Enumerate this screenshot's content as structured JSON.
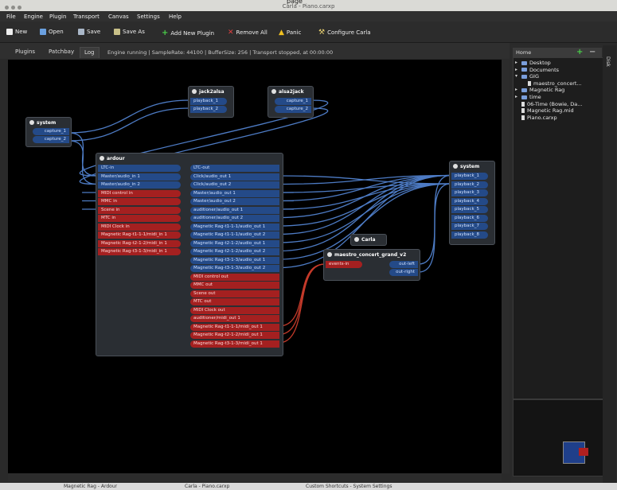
{
  "window": {
    "title": "Carla - Piano.carxp",
    "page_title_left": "page"
  },
  "menu": [
    "File",
    "Engine",
    "Plugin",
    "Transport",
    "Canvas",
    "Settings",
    "Help"
  ],
  "toolbar": [
    "New",
    "Open",
    "Save",
    "Save As",
    "Add New Plugin",
    "Remove All",
    "Panic",
    "Configure Carla"
  ],
  "tabs": [
    "Plugins",
    "Patchbay",
    "Log"
  ],
  "status": "Engine running | SampleRate: 44100 | BufferSize: 256 | Transport stopped, at 00:00:00",
  "nodes": {
    "system_in": {
      "title": "system",
      "ports": [
        "capture_1",
        "capture_2"
      ]
    },
    "jack2alsa": {
      "title": "jack2alsa",
      "ports": [
        "playback_1",
        "playback_2"
      ]
    },
    "alsa2jack": {
      "title": "alsa2jack",
      "ports": [
        "capture_1",
        "capture_2"
      ]
    },
    "ardour": {
      "title": "ardour",
      "inputs": [
        "LTC-in",
        "Master/audio_in 1",
        "Master/audio_in 2",
        "MIDI control in",
        "MMC in",
        "Scene in",
        "MTC in",
        "MIDI Clock in",
        "Magnetic Rag-t1-1-1/midi_in 1",
        "Magnetic Rag-t2-1-2/midi_in 1",
        "Magnetic Rag-t3-1-3/midi_in 1"
      ],
      "input_types": [
        "a",
        "a",
        "a",
        "m",
        "m",
        "m",
        "m",
        "m",
        "m",
        "m",
        "m"
      ],
      "outputs": [
        "LTC-out",
        "Click/audio_out 1",
        "Click/audio_out 2",
        "Master/audio_out 1",
        "Master/audio_out 2",
        "auditioner/audio_out 1",
        "auditioner/audio_out 2",
        "Magnetic Rag-t1-1-1/audio_out 1",
        "Magnetic Rag-t1-1-1/audio_out 2",
        "Magnetic Rag-t2-1-2/audio_out 1",
        "Magnetic Rag-t2-1-2/audio_out 2",
        "Magnetic Rag-t3-1-3/audio_out 1",
        "Magnetic Rag-t3-1-3/audio_out 2",
        "MIDI control out",
        "MMC out",
        "Scene out",
        "MTC out",
        "MIDI Clock out",
        "auditioner/midi_out 1",
        "Magnetic Rag-t1-1-1/midi_out 1",
        "Magnetic Rag-t2-1-2/midi_out 1",
        "Magnetic Rag-t3-1-3/midi_out 1"
      ],
      "output_types": [
        "a",
        "a",
        "a",
        "a",
        "a",
        "a",
        "a",
        "a",
        "a",
        "a",
        "a",
        "a",
        "a",
        "m",
        "m",
        "m",
        "m",
        "m",
        "m",
        "m",
        "m",
        "m"
      ]
    },
    "carla": {
      "title": "Carla"
    },
    "maestro": {
      "title": "maestro_concert_grand_v2",
      "inputs": [
        "events-in"
      ],
      "outputs": [
        "out-left",
        "out-right"
      ]
    },
    "system_out": {
      "title": "system",
      "ports": [
        "playback_1",
        "playback_2",
        "playback_3",
        "playback_4",
        "playback_5",
        "playback_6",
        "playback_7",
        "playback_8"
      ]
    }
  },
  "side": {
    "home_label": "Home",
    "disk_tab": "Disk",
    "tree": [
      {
        "label": "Desktop",
        "type": "folder",
        "indent": 0,
        "expanded": false
      },
      {
        "label": "Documents",
        "type": "folder",
        "indent": 0,
        "expanded": false
      },
      {
        "label": "GIG",
        "type": "folder",
        "indent": 0,
        "expanded": true
      },
      {
        "label": "maestro_concert...",
        "type": "file",
        "indent": 1
      },
      {
        "label": "Magnetic Rag",
        "type": "folder",
        "indent": 0,
        "expanded": false
      },
      {
        "label": "time",
        "type": "folder",
        "indent": 0,
        "expanded": false
      },
      {
        "label": "06-Time (Bowie, Da...",
        "type": "file",
        "indent": 0
      },
      {
        "label": "Magnetic Rag.mid",
        "type": "file",
        "indent": 0
      },
      {
        "label": "Piano.carxp",
        "type": "file",
        "indent": 0
      }
    ]
  },
  "taskbar": [
    "Magnetic Rag - Ardour",
    "Carla - Piano.carxp",
    "Custom Shortcuts - System Settings"
  ],
  "colors": {
    "audio_port": "#244a88",
    "midi_port": "#a42020",
    "audio_wire": "#4d7bc4",
    "midi_wire": "#c43a2a",
    "canvas": "#000000"
  }
}
